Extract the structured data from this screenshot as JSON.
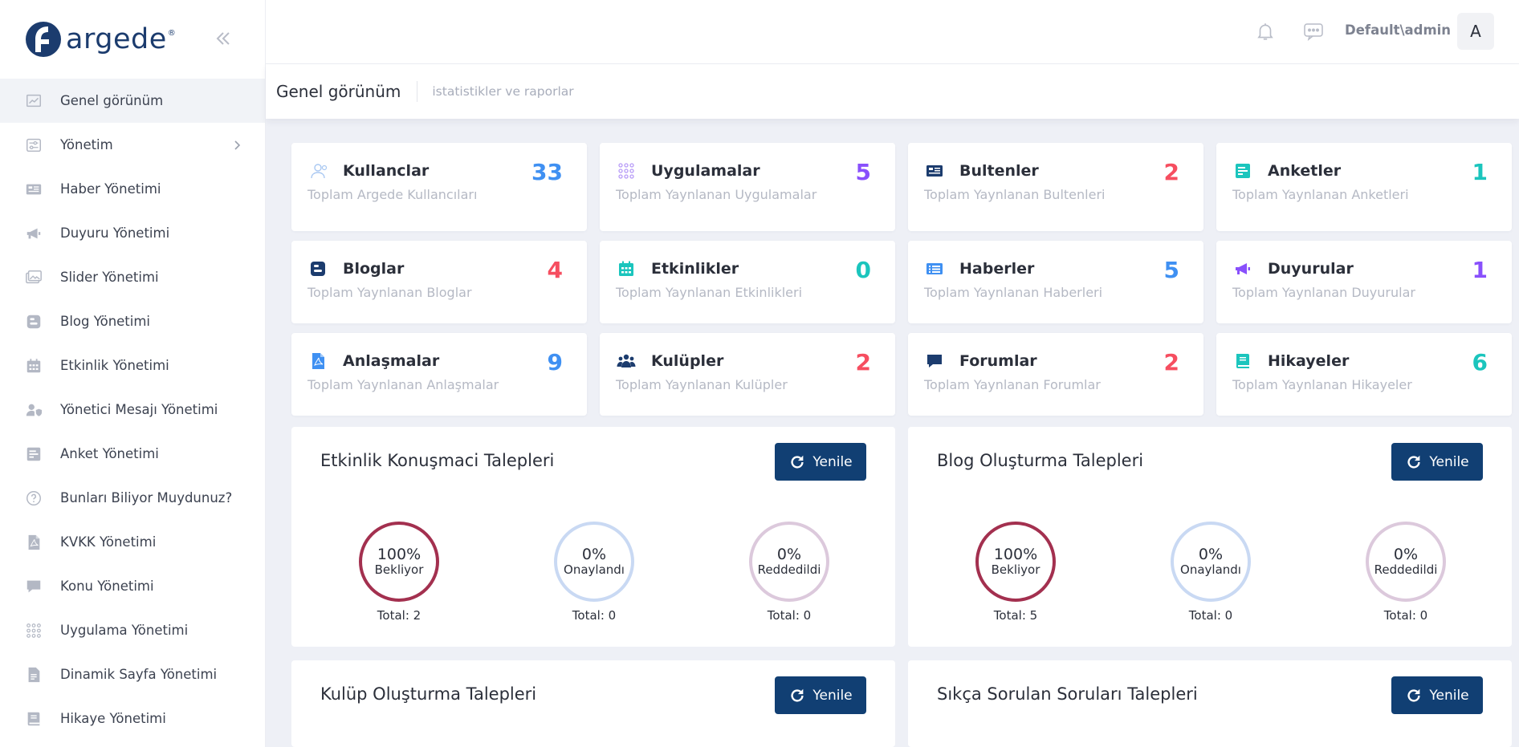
{
  "brand": {
    "name": "argede",
    "mark": "®",
    "color": "#1c3c6e"
  },
  "sidebar": {
    "items": [
      {
        "label": "Genel görünüm",
        "icon": "chart-icon",
        "active": true
      },
      {
        "label": "Yönetim",
        "icon": "sliders-icon",
        "has_children": true
      },
      {
        "label": "Haber Yönetimi",
        "icon": "newspaper-icon"
      },
      {
        "label": "Duyuru Yönetimi",
        "icon": "megaphone-icon"
      },
      {
        "label": "Slider Yönetimi",
        "icon": "images-icon"
      },
      {
        "label": "Blog Yönetimi",
        "icon": "blogger-icon"
      },
      {
        "label": "Etkinlik Yönetimi",
        "icon": "calendar-icon"
      },
      {
        "label": "Yönetici Mesajı Yönetimi",
        "icon": "user-shield-icon"
      },
      {
        "label": "Anket Yönetimi",
        "icon": "poll-icon"
      },
      {
        "label": "Bunları Biliyor Muydunuz?",
        "icon": "question-icon"
      },
      {
        "label": "KVKK Yönetimi",
        "icon": "file-pdf-icon"
      },
      {
        "label": "Konu Yönetimi",
        "icon": "comment-icon"
      },
      {
        "label": "Uygulama Yönetimi",
        "icon": "grid-dots-icon"
      },
      {
        "label": "Dinamik Sayfa Yönetimi",
        "icon": "file-icon"
      },
      {
        "label": "Hikaye Yönetimi",
        "icon": "book-icon"
      }
    ]
  },
  "header": {
    "user": "Default\\admin",
    "avatar_initial": "A"
  },
  "subheader": {
    "title": "Genel görünüm",
    "subtitle": "istatistikler ve raporlar"
  },
  "stats": [
    {
      "title": "Kullanclar",
      "subtitle": "Toplam Argede Kullancıları",
      "value": "33",
      "color": "#3f90f2",
      "icon": "users-icon"
    },
    {
      "title": "Uygulamalar",
      "subtitle": "Toplam Yaynlanan Uygulamalar",
      "value": "5",
      "color": "#8950fc",
      "icon": "grid-dots-icon"
    },
    {
      "title": "Bultenler",
      "subtitle": "Toplam Yaynlanan Bultenleri",
      "value": "2",
      "color": "#f64e60",
      "icon": "newspaper-icon"
    },
    {
      "title": "Anketler",
      "subtitle": "Toplam Yaynlanan Anketleri",
      "value": "1",
      "color": "#1bc5bd",
      "icon": "poll-icon"
    },
    {
      "title": "Bloglar",
      "subtitle": "Toplam Yaynlanan Bloglar",
      "value": "4",
      "color": "#f64e60",
      "icon": "blogger-icon"
    },
    {
      "title": "Etkinlikler",
      "subtitle": "Toplam Yaynlanan Etkinlikleri",
      "value": "0",
      "color": "#1bc5bd",
      "icon": "calendar-icon"
    },
    {
      "title": "Haberler",
      "subtitle": "Toplam Yaynlanan Haberleri",
      "value": "5",
      "color": "#3f90f2",
      "icon": "list-icon"
    },
    {
      "title": "Duyurular",
      "subtitle": "Toplam Yaynlanan Duyurular",
      "value": "1",
      "color": "#8950fc",
      "icon": "megaphone-icon"
    },
    {
      "title": "Anlaşmalar",
      "subtitle": "Toplam Yaynlanan Anlaşmalar",
      "value": "9",
      "color": "#3f90f2",
      "icon": "file-pdf-icon"
    },
    {
      "title": "Kulüpler",
      "subtitle": "Toplam Yaynlanan Kulüpler",
      "value": "2",
      "color": "#f64e60",
      "icon": "group-icon"
    },
    {
      "title": "Forumlar",
      "subtitle": "Toplam Yaynlanan Forumlar",
      "value": "2",
      "color": "#f64e60",
      "icon": "comment-icon"
    },
    {
      "title": "Hikayeler",
      "subtitle": "Toplam Yaynlanan Hikayeler",
      "value": "6",
      "color": "#1bc5bd",
      "icon": "book-icon"
    }
  ],
  "refresh_label": "Yenile",
  "panels": [
    {
      "title": "Etkinlik Konuşmaci Talepleri",
      "gauges": [
        {
          "percent": "100%",
          "label": "Bekliyor",
          "total": "Total: 2",
          "color": "#a3304f"
        },
        {
          "percent": "0%",
          "label": "Onaylandı",
          "total": "Total: 0",
          "color": "#c9d9f3"
        },
        {
          "percent": "0%",
          "label": "Reddedildi",
          "total": "Total: 0",
          "color": "#dcc9dc"
        }
      ]
    },
    {
      "title": "Blog Oluşturma Talepleri",
      "gauges": [
        {
          "percent": "100%",
          "label": "Bekliyor",
          "total": "Total: 5",
          "color": "#a3304f"
        },
        {
          "percent": "0%",
          "label": "Onaylandı",
          "total": "Total: 0",
          "color": "#c9d9f3"
        },
        {
          "percent": "0%",
          "label": "Reddedildi",
          "total": "Total: 0",
          "color": "#dcc9dc"
        }
      ]
    },
    {
      "title": "Kulüp Oluşturma Talepleri"
    },
    {
      "title": "Sıkça Sorulan Soruları Talepleri"
    }
  ]
}
